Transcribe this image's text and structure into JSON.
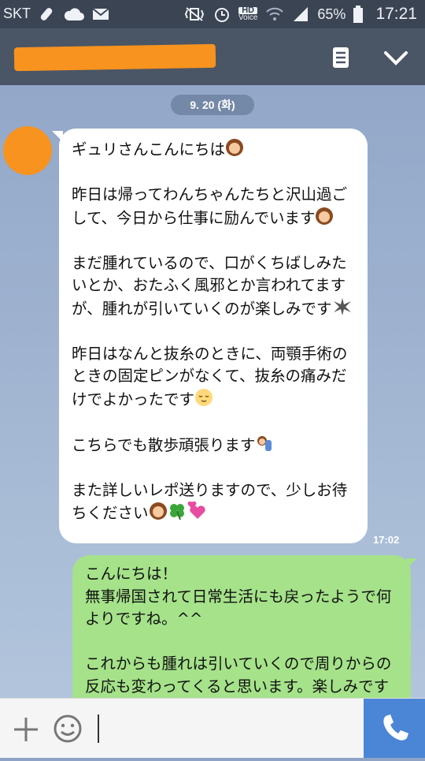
{
  "status_bar": {
    "carrier": "SKT",
    "hd_label": "HD",
    "voice_label": "Voice",
    "battery": "65%",
    "time": "17:21"
  },
  "date_separator": "9. 20 (화)",
  "messages": {
    "incoming": {
      "line1": "ギュリさんこんにちは",
      "para2": "昨日は帰ってわんちゃんたちと沢山過ごして、今日から仕事に励んでいます",
      "para3": "まだ腫れているので、口がくちばしみたいとか、おたふく風邪とか言われてますが、腫れが引いていくのが楽しみです",
      "para4": "昨日はなんと抜糸のときに、両顎手術のときの固定ピンがなくて、抜糸の痛みだけでよかったです",
      "para5": "こちらでも散歩頑張ります",
      "para6": "また詳しいレポ送りますので、少しお待ちください",
      "time": "17:02"
    },
    "outgoing": {
      "para1": "こんにちは！\n無事帰国されて日常生活にも戻ったようで何よりですね。^^",
      "para2": "これからも腫れは引いていくので周りからの反応も変わってくると思います。楽しみですね。^^"
    }
  },
  "colors": {
    "status_bar": "#3a4453",
    "header": "#4a5566",
    "title_redaction": "#f7931e",
    "avatar": "#f7931e",
    "incoming_bubble": "#ffffff",
    "outgoing_bubble": "#a5e28a",
    "call_button": "#4b85d6"
  },
  "icons": [
    "link-icon",
    "cloud-icon",
    "mail-icon",
    "vibrate-icon",
    "alarm-icon",
    "wifi-icon",
    "signal-icon",
    "battery-icon",
    "notes-icon",
    "chevron-down-icon",
    "plus-icon",
    "emoji-icon",
    "phone-icon"
  ]
}
